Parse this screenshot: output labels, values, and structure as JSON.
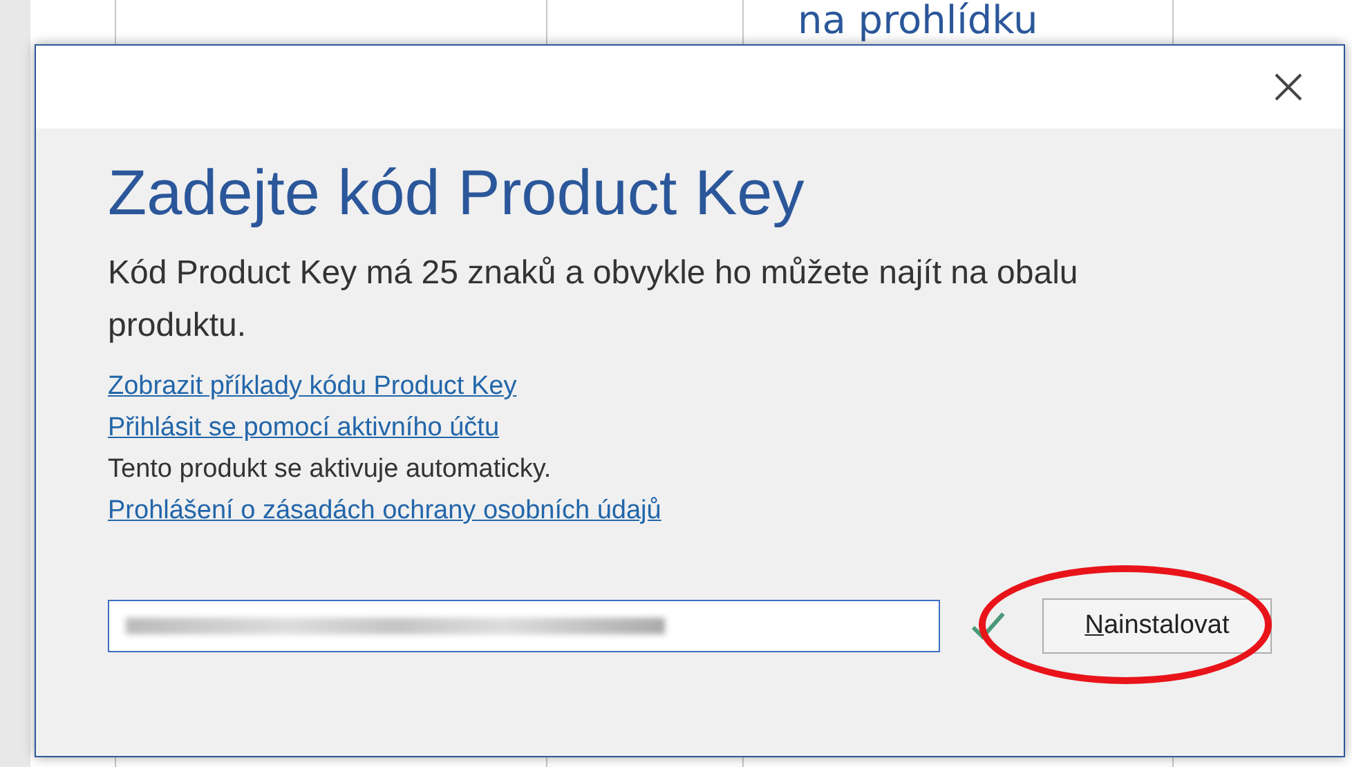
{
  "background_document": {
    "text": "na prohlídku"
  },
  "dialog": {
    "title": "Zadejte kód Product Key",
    "description": "Kód Product Key má 25 znaků a obvykle ho můžete najít na obalu produktu.",
    "lines": [
      {
        "kind": "link",
        "text": "Zobrazit příklady kódu Product Key"
      },
      {
        "kind": "link",
        "text": "Přihlásit se pomocí aktivního účtu"
      },
      {
        "kind": "text",
        "text": "Tento produkt se aktivuje automaticky."
      },
      {
        "kind": "link",
        "text": "Prohlášení o zásadách ochrany osobních údajů"
      }
    ],
    "key_field": {
      "redacted": true,
      "valid": true
    },
    "install_button": {
      "label": "Nainstalovat",
      "highlighted": true
    }
  }
}
